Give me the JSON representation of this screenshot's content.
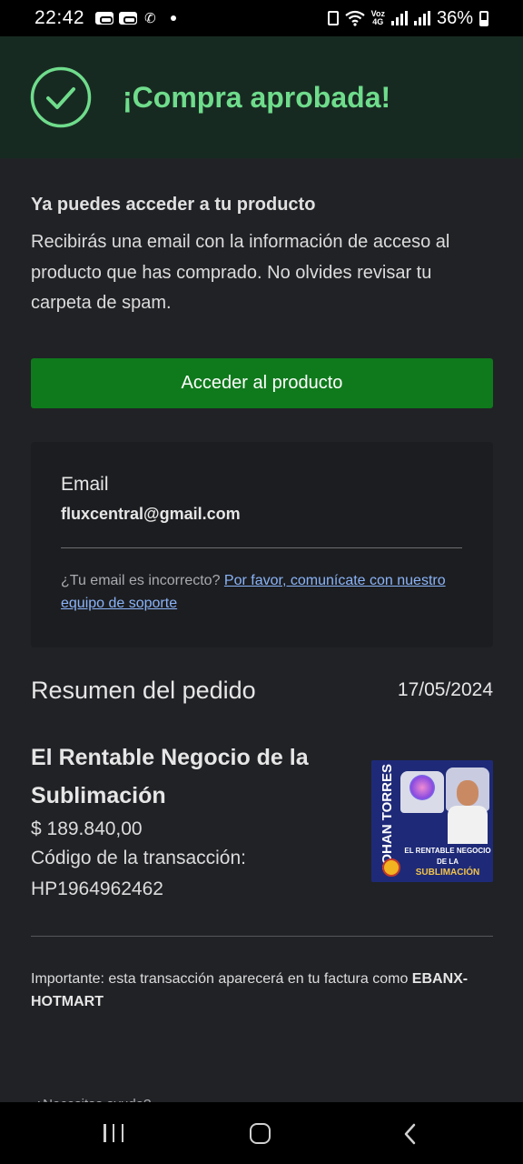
{
  "status_bar": {
    "time": "22:42",
    "battery": "36%",
    "icons": [
      "voicemail-icon",
      "voicemail-icon",
      "wifi-call-icon",
      "notification-dot-icon",
      "sim-icon",
      "wifi-icon",
      "volte-4g-icon",
      "signal-icon",
      "signal-roaming-icon",
      "battery-icon"
    ],
    "volte_top": "Voz",
    "volte_bottom": "4G"
  },
  "banner": {
    "title": "¡Compra aprobada!",
    "icon": "check-circle-icon",
    "accent_color": "#6fdc8c",
    "background": "#172a21"
  },
  "access": {
    "heading": "Ya puedes acceder a tu producto",
    "text": "Recibirás una email con la información de acceso al producto que has comprado. No olvides revisar tu carpeta de spam.",
    "button_label": "Acceder al producto",
    "button_color": "#0f7a1c"
  },
  "email_card": {
    "label": "Email",
    "value": "fluxcentral@gmail.com",
    "help_text": "¿Tu email es incorrecto? ",
    "support_link": "Por favor, comunícate con nuestro equipo de soporte"
  },
  "order_summary": {
    "title": "Resumen del pedido",
    "date": "17/05/2024",
    "product_name": "El Rentable Negocio de la Sublimación",
    "price": "$ 189.840,00",
    "transaction_label": "Código de la transacción:",
    "transaction_code": "HP1964962462",
    "thumbnail": {
      "vertical_text": "JOHAN TORRES",
      "caption_top": "EL RENTABLE NEGOCIO DE LA",
      "caption_bottom": "SUBLIMACIÓN"
    }
  },
  "important": {
    "prefix": "Importante: esta transacción aparecerá en tu factura como ",
    "merchant": "EBANX-HOTMART"
  },
  "partial_text": "¿Necesitas ayuda?",
  "nav_bar": {
    "icons": [
      "recent-apps-icon",
      "home-icon",
      "back-icon"
    ]
  }
}
